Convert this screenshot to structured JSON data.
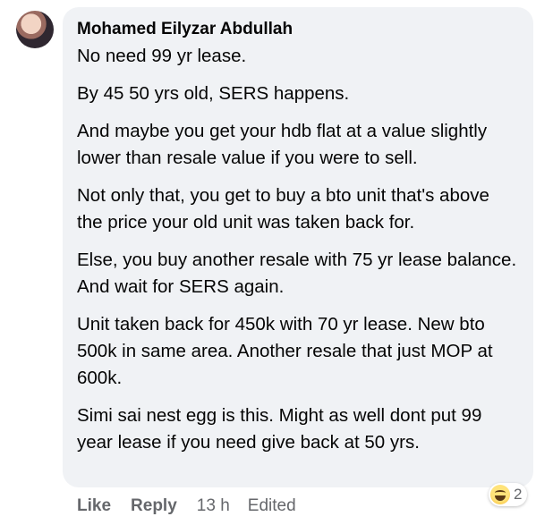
{
  "comment": {
    "author": "Mohamed Eilyzar Abdullah",
    "paragraphs": [
      "No need 99 yr lease.",
      "By 45 50 yrs old, SERS happens.",
      "And maybe you get your hdb flat at a value slightly lower than resale value if you were to sell.",
      "Not only that, you get to buy a bto unit that's above the price your old unit was taken back for.",
      "Else, you buy another resale with 75 yr lease balance. And wait for SERS again.",
      "Unit taken back for 450k with 70 yr lease. New bto 500k in same area. Another resale that just MOP at 600k.",
      "Simi sai nest egg is this. Might as well dont put 99 year lease if you need give back at 50 yrs."
    ],
    "reaction": {
      "icon": "haha-emoji-icon",
      "count": "2"
    },
    "actions": {
      "like": "Like",
      "reply": "Reply",
      "time": "13 h",
      "edited": "Edited"
    }
  }
}
